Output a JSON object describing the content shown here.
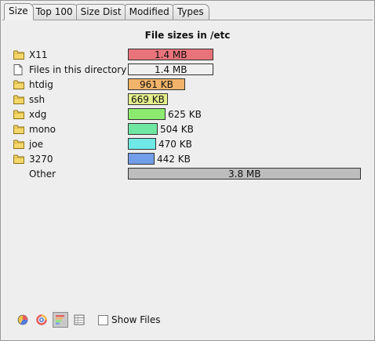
{
  "tabs": [
    {
      "label": "Size",
      "active": true
    },
    {
      "label": "Top 100",
      "active": false
    },
    {
      "label": "Size Dist",
      "active": false
    },
    {
      "label": "Modified",
      "active": false
    },
    {
      "label": "Types",
      "active": false
    }
  ],
  "title": "File sizes in /etc",
  "chart_data": {
    "type": "bar",
    "categories": [
      "X11",
      "Files in this directory",
      "htdig",
      "ssh",
      "xdg",
      "mono",
      "joe",
      "3270",
      "Other"
    ],
    "labels": [
      "1.4 MB",
      "1.4 MB",
      "961 KB",
      "669 KB",
      "625 KB",
      "504 KB",
      "470 KB",
      "442 KB",
      "3.8 MB"
    ],
    "values_kb": [
      1434,
      1434,
      961,
      669,
      625,
      504,
      470,
      442,
      3891
    ],
    "colors": [
      "#e8737a",
      "#f0f0f0",
      "#f1b46a",
      "#e4f08c",
      "#8cea70",
      "#6fe6a2",
      "#6fe8e6",
      "#729de8",
      "#bdbdbd"
    ],
    "icons": [
      "folder-icon",
      "file-icon",
      "folder-icon",
      "folder-icon",
      "folder-icon",
      "folder-icon",
      "folder-icon",
      "folder-icon",
      "none"
    ]
  },
  "footer": {
    "buttons": [
      "pie-chart-icon",
      "ring-chart-icon",
      "bar-chart-icon",
      "table-view-icon"
    ],
    "pressed_button": "bar-chart-icon",
    "show_files_label": "Show Files",
    "show_files_checked": false
  }
}
